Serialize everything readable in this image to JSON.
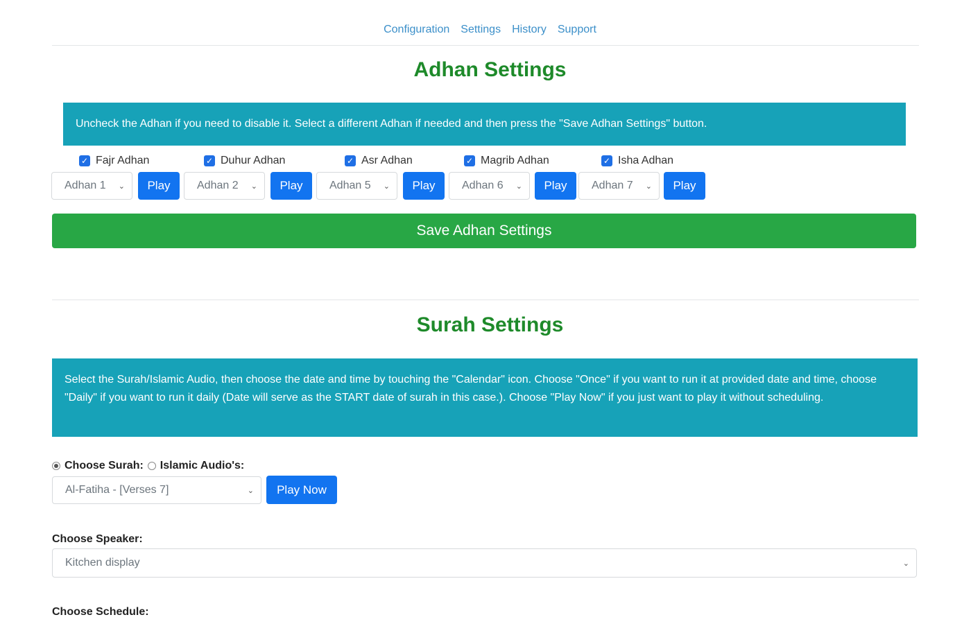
{
  "nav": {
    "items": [
      "Configuration",
      "Settings",
      "History",
      "Support"
    ]
  },
  "adhan": {
    "title": "Adhan Settings",
    "info": "Uncheck the Adhan if you need to disable it. Select a different Adhan if needed and then press the \"Save Adhan Settings\" button.",
    "prayers": [
      {
        "label": "Fajr Adhan",
        "checked": true,
        "selected": "Adhan 1",
        "play": "Play"
      },
      {
        "label": "Duhur Adhan",
        "checked": true,
        "selected": "Adhan 2",
        "play": "Play"
      },
      {
        "label": "Asr Adhan",
        "checked": true,
        "selected": "Adhan 5",
        "play": "Play"
      },
      {
        "label": "Magrib Adhan",
        "checked": true,
        "selected": "Adhan 6",
        "play": "Play"
      },
      {
        "label": "Isha Adhan",
        "checked": true,
        "selected": "Adhan 7",
        "play": "Play"
      }
    ],
    "save_label": "Save Adhan Settings"
  },
  "surah": {
    "title": "Surah Settings",
    "info": "Select the Surah/Islamic Audio, then choose the date and time by touching the \"Calendar\" icon. Choose \"Once\" if you want to run it at provided date and time, choose \"Daily\" if you want to run it daily (Date will serve as the START date of surah in this case.). Choose \"Play Now\" if you just want to play it without scheduling.",
    "radio_surah": "Choose Surah:",
    "radio_audio": "Islamic Audio's:",
    "surah_selected": "Al-Fatiha - [Verses 7]",
    "play_now": "Play Now",
    "speaker_label": "Choose Speaker:",
    "speaker_selected": "Kitchen display",
    "schedule_label": "Choose Schedule:"
  }
}
